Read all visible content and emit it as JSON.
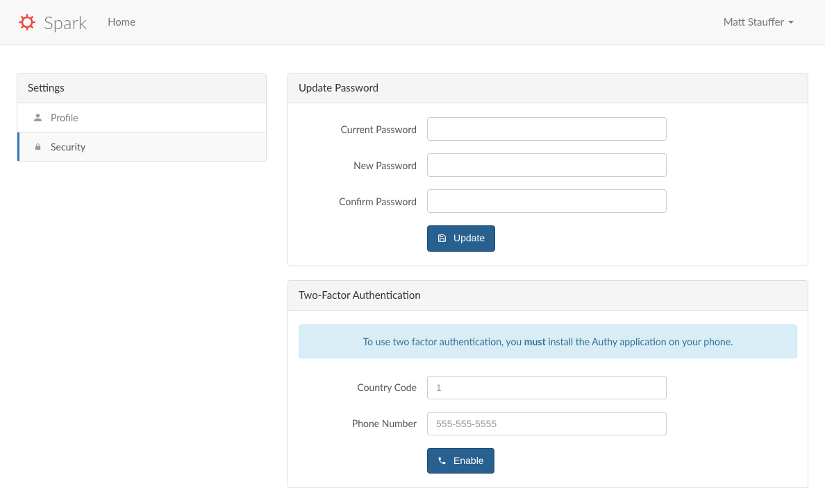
{
  "nav": {
    "brand": "Spark",
    "home": "Home",
    "user": "Matt Stauffer"
  },
  "sidebar": {
    "title": "Settings",
    "items": [
      {
        "label": "Profile",
        "icon": "user-icon"
      },
      {
        "label": "Security",
        "icon": "lock-icon"
      }
    ]
  },
  "password_panel": {
    "title": "Update Password",
    "current_label": "Current Password",
    "new_label": "New Password",
    "confirm_label": "Confirm Password",
    "button": "Update"
  },
  "twofactor_panel": {
    "title": "Two-Factor Authentication",
    "info_pre": "To use two factor authentication, you ",
    "info_strong": "must",
    "info_post": " install the Authy application on your phone.",
    "country_label": "Country Code",
    "country_placeholder": "1",
    "phone_label": "Phone Number",
    "phone_placeholder": "555-555-5555",
    "button": "Enable"
  }
}
